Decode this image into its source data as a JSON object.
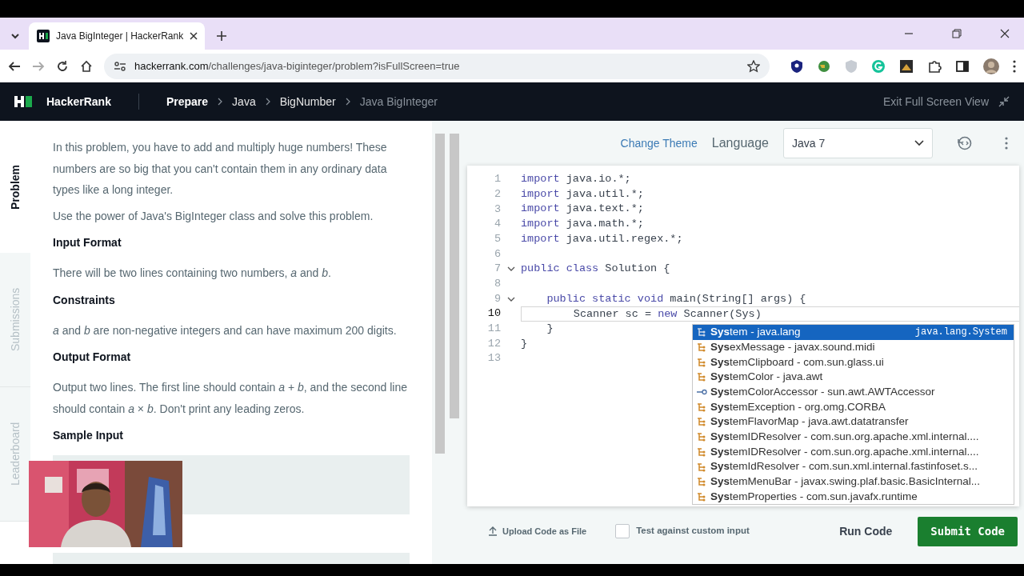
{
  "browser": {
    "tab_title": "Java BigInteger | HackerRank",
    "url_host": "hackerrank.com",
    "url_path": "/challenges/java-biginteger/problem?isFullScreen=true"
  },
  "header": {
    "brand": "HackerRank",
    "breadcrumbs": [
      {
        "label": "Prepare",
        "kind": "root"
      },
      {
        "label": "Java",
        "kind": "link"
      },
      {
        "label": "BigNumber",
        "kind": "link"
      },
      {
        "label": "Java BigInteger",
        "kind": "current"
      }
    ],
    "exit": "Exit Full Screen View"
  },
  "side_tabs": [
    {
      "label": "Problem",
      "selected": true
    },
    {
      "label": "Submissions",
      "selected": false
    },
    {
      "label": "Leaderboard",
      "selected": false
    }
  ],
  "problem": [
    {
      "kind": "para",
      "text": "In this problem, you have to add and multiply huge numbers! These numbers are so big that you can't contain them in any ordinary data types like a long integer."
    },
    {
      "kind": "para",
      "text": "Use the power of Java's BigInteger class and solve this problem."
    },
    {
      "kind": "heading",
      "text": "Input Format"
    },
    {
      "kind": "para",
      "text": "There will be two lines containing two numbers, *a* and *b*."
    },
    {
      "kind": "heading",
      "text": "Constraints"
    },
    {
      "kind": "para",
      "text": "*a* and *b* are non-negative integers and can have maximum 200 digits."
    },
    {
      "kind": "heading",
      "text": "Output Format"
    },
    {
      "kind": "para",
      "text": "Output two lines. The first line should contain *a* + *b*, and the second line should contain *a* × *b*. Don't print any leading zeros."
    },
    {
      "kind": "heading",
      "text": "Sample Input"
    },
    {
      "kind": "sample"
    },
    {
      "kind": "gap"
    },
    {
      "kind": "sample"
    }
  ],
  "editor": {
    "change_theme": "Change Theme",
    "language_label": "Language",
    "language": "Java 7",
    "lines": [
      {
        "number": "1",
        "fold": false,
        "current": false,
        "tokens": [
          {
            "t": "import",
            "kind": "keyword"
          },
          {
            "t": " java.io.*;",
            "kind": "plain"
          }
        ]
      },
      {
        "number": "2",
        "fold": false,
        "current": false,
        "tokens": [
          {
            "t": "import",
            "kind": "keyword"
          },
          {
            "t": " java.util.*;",
            "kind": "plain"
          }
        ]
      },
      {
        "number": "3",
        "fold": false,
        "current": false,
        "tokens": [
          {
            "t": "import",
            "kind": "keyword"
          },
          {
            "t": " java.text.*;",
            "kind": "plain"
          }
        ]
      },
      {
        "number": "4",
        "fold": false,
        "current": false,
        "tokens": [
          {
            "t": "import",
            "kind": "keyword"
          },
          {
            "t": " java.math.*;",
            "kind": "plain"
          }
        ]
      },
      {
        "number": "5",
        "fold": false,
        "current": false,
        "tokens": [
          {
            "t": "import",
            "kind": "keyword"
          },
          {
            "t": " java.util.regex.*;",
            "kind": "plain"
          }
        ]
      },
      {
        "number": "6",
        "fold": false,
        "current": false
      },
      {
        "number": "7",
        "fold": true,
        "current": false,
        "tokens": [
          {
            "t": "public class",
            "kind": "keyword"
          },
          {
            "t": " Solution {",
            "kind": "plain"
          }
        ]
      },
      {
        "number": "8",
        "fold": false,
        "current": false
      },
      {
        "number": "9",
        "fold": true,
        "current": false,
        "tokens": [
          {
            "t": "    public static void",
            "kind": "keyword"
          },
          {
            "t": " main(String[] args) {",
            "kind": "plain"
          }
        ]
      },
      {
        "number": "10",
        "fold": false,
        "current": true,
        "tokens": [
          {
            "t": "        Scanner sc = ",
            "kind": "plain"
          },
          {
            "t": "new",
            "kind": "keyword"
          },
          {
            "t": " Scanner(Sys)",
            "kind": "plain"
          }
        ]
      },
      {
        "number": "11",
        "fold": false,
        "current": false,
        "tokens": [
          {
            "t": "    }",
            "kind": "plain"
          }
        ]
      },
      {
        "number": "12",
        "fold": false,
        "current": false,
        "tokens": [
          {
            "t": "}",
            "kind": "plain"
          }
        ]
      },
      {
        "number": "13",
        "fold": false,
        "current": false
      }
    ]
  },
  "autocomplete": [
    {
      "kind": "class",
      "label": "**Sys**tem - java.lang",
      "detail": "java.lang.System",
      "selected": true
    },
    {
      "kind": "class",
      "label": "**Sys**exMessage - javax.sound.midi",
      "selected": false
    },
    {
      "kind": "class",
      "label": "**Sys**temClipboard - com.sun.glass.ui",
      "selected": false
    },
    {
      "kind": "class",
      "label": "**Sys**temColor - java.awt",
      "selected": false
    },
    {
      "kind": "interface",
      "label": "**Sys**temColorAccessor - sun.awt.AWTAccessor",
      "selected": false
    },
    {
      "kind": "class",
      "label": "**Sys**temException - org.omg.CORBA",
      "selected": false
    },
    {
      "kind": "class",
      "label": "**Sys**temFlavorMap - java.awt.datatransfer",
      "selected": false
    },
    {
      "kind": "class",
      "label": "**Sys**temIDResolver - com.sun.org.apache.xml.internal....",
      "selected": false
    },
    {
      "kind": "class",
      "label": "**Sys**temIDResolver - com.sun.org.apache.xml.internal....",
      "selected": false
    },
    {
      "kind": "class",
      "label": "**Sys**temIdResolver - com.sun.xml.internal.fastinfoset.s...",
      "selected": false
    },
    {
      "kind": "class",
      "label": "**Sys**temMenuBar - javax.swing.plaf.basic.BasicInternal...",
      "selected": false
    },
    {
      "kind": "class",
      "label": "**Sys**temProperties - com.sun.javafx.runtime",
      "selected": false
    }
  ],
  "footer": {
    "upload": "Upload Code as File",
    "custom_input": {
      "label": "Test against custom input",
      "checked": false
    },
    "run": "Run Code",
    "submit": "Submit Code"
  }
}
